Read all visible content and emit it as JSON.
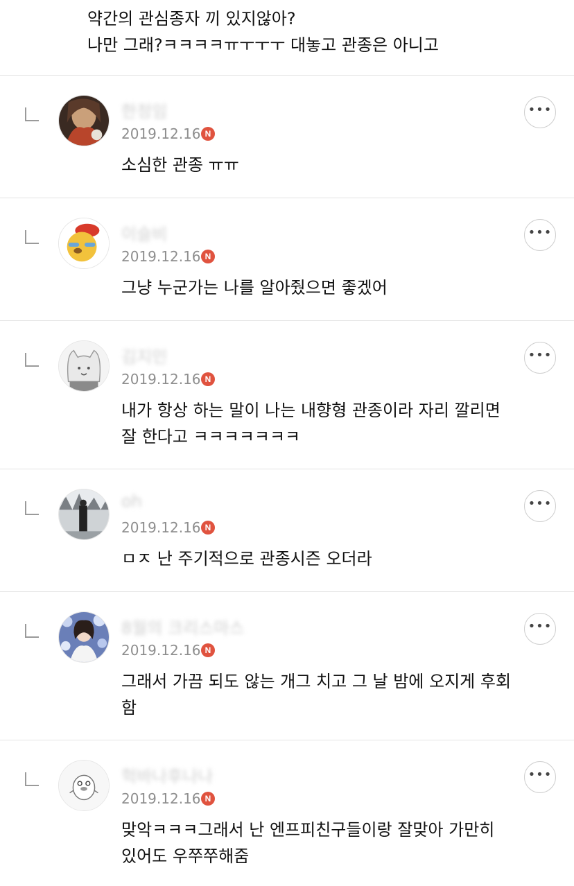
{
  "post": {
    "lines": [
      "약간의 관심종자 끼 있지않아?",
      "나만 그래?ㅋㅋㅋㅋㅠㅜㅜㅜ 대놓고 관종은 아니고"
    ]
  },
  "badge_label": "N",
  "more_label": "•••",
  "comments": [
    {
      "name": "한정임",
      "date": "2019.12.16",
      "lines": [
        "소심한 관종 ㅠㅠ"
      ]
    },
    {
      "name": "이슬비",
      "date": "2019.12.16",
      "lines": [
        "그냥 누군가는 나를 알아줬으면 좋겠어"
      ]
    },
    {
      "name": "김지민",
      "date": "2019.12.16",
      "lines": [
        "내가 항상 하는 말이 나는 내향형 관종이라 자리 깔리면",
        "잘 한다고 ㅋㅋㅋㅋㅋㅋㅋ"
      ]
    },
    {
      "name": "oh",
      "date": "2019.12.16",
      "lines": [
        "ㅁㅈ 난 주기적으로 관종시즌 오더라"
      ]
    },
    {
      "name": "8월의 크리스마스",
      "date": "2019.12.16",
      "lines": [
        "그래서 가끔 되도 않는 개그 치고 그 날 밤에 오지게 후회",
        "함"
      ]
    },
    {
      "name": "헉바나후나나",
      "date": "2019.12.16",
      "lines": [
        "맞악ㅋㅋㅋ그래서 난 엔프피친구들이랑 잘맞아 가만히",
        "있어도 우쭈쭈해줌"
      ]
    }
  ],
  "colors": {
    "badge": "#e0533f",
    "divider": "#e3e3e3",
    "date": "#8e8e8e"
  }
}
